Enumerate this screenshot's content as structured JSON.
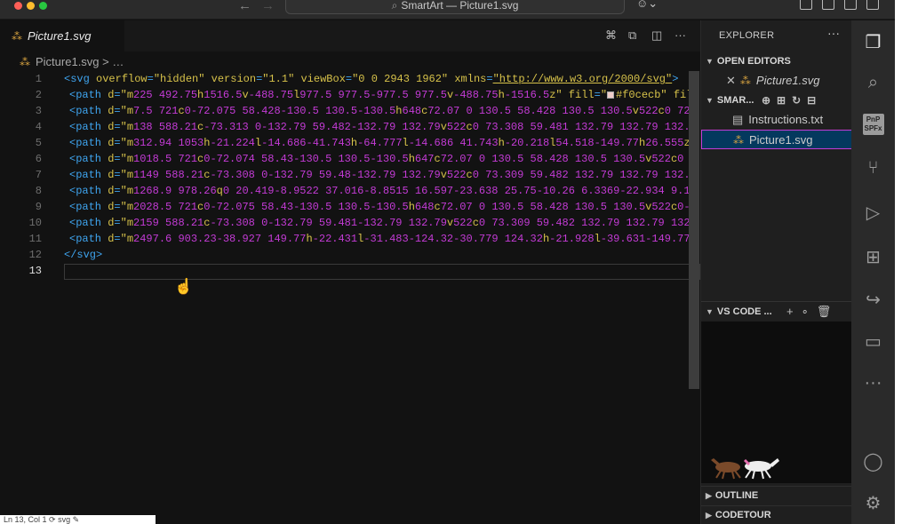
{
  "titlebar": {
    "back_glyph": "←",
    "forward_glyph": "→",
    "command_center_text": "SmartArt — Picture1.svg",
    "search_glyph": "⌕",
    "copilot_glyph": "☺⌄"
  },
  "editor": {
    "tab_label": "Picture1.svg",
    "tab_icon": "svg-file-icon",
    "breadcrumb_file": "Picture1.svg",
    "breadcrumb_rest": "> …",
    "line_numbers": [
      "1",
      "2",
      "3",
      "4",
      "5",
      "6",
      "7",
      "8",
      "9",
      "10",
      "11",
      "12",
      "13"
    ],
    "current_line": "13",
    "lines": [
      [
        [
          "tag",
          "<svg "
        ],
        [
          "attr",
          "overflow"
        ],
        [
          "tag",
          "="
        ],
        [
          "str",
          "\"hidden\""
        ],
        [
          "tag",
          " "
        ],
        [
          "attr",
          "version"
        ],
        [
          "tag",
          "="
        ],
        [
          "str",
          "\"1.1\""
        ],
        [
          "tag",
          " "
        ],
        [
          "attr",
          "viewBox"
        ],
        [
          "tag",
          "="
        ],
        [
          "str",
          "\"0 0 2943 1962\""
        ],
        [
          "tag",
          " "
        ],
        [
          "attr",
          "xmlns"
        ],
        [
          "tag",
          "="
        ],
        [
          "url",
          "\"http://www.w3.org/2000/svg\""
        ],
        [
          "tag",
          ">"
        ]
      ],
      [
        [
          "tag",
          "<path "
        ],
        [
          "attr",
          "d"
        ],
        [
          "tag",
          "="
        ],
        [
          "str",
          "\""
        ],
        [
          "cmd",
          "m"
        ],
        [
          "num",
          "225 492.75"
        ],
        [
          "cmd",
          "h"
        ],
        [
          "num",
          "1516.5"
        ],
        [
          "cmd",
          "v"
        ],
        [
          "num",
          "-488.75"
        ],
        [
          "cmd",
          "l"
        ],
        [
          "num",
          "977.5 977.5-977.5 977.5"
        ],
        [
          "cmd",
          "v"
        ],
        [
          "num",
          "-488.75"
        ],
        [
          "cmd",
          "h"
        ],
        [
          "num",
          "-1516.5"
        ],
        [
          "cmd",
          "z"
        ],
        [
          "str",
          "\""
        ],
        [
          "tag",
          " "
        ],
        [
          "attr",
          "fill"
        ],
        [
          "tag",
          "="
        ],
        [
          "str",
          "\""
        ],
        [
          "swatch",
          "#f0cecb"
        ],
        [
          "str",
          "#f0cecb\""
        ],
        [
          "tag",
          " "
        ],
        [
          "attr",
          "fill"
        ]
      ],
      [
        [
          "tag",
          "<path "
        ],
        [
          "attr",
          "d"
        ],
        [
          "tag",
          "="
        ],
        [
          "str",
          "\""
        ],
        [
          "cmd",
          "m"
        ],
        [
          "num",
          "7.5 721"
        ],
        [
          "cmd",
          "c"
        ],
        [
          "num",
          "0-72.075 58.428-130.5 130.5-130.5"
        ],
        [
          "cmd",
          "h"
        ],
        [
          "num",
          "648"
        ],
        [
          "cmd",
          "c"
        ],
        [
          "num",
          "72.07 0 130.5 58.428 130.5 130.5"
        ],
        [
          "cmd",
          "v"
        ],
        [
          "num",
          "522"
        ],
        [
          "cmd",
          "c"
        ],
        [
          "num",
          "0 72."
        ]
      ],
      [
        [
          "tag",
          "<path "
        ],
        [
          "attr",
          "d"
        ],
        [
          "tag",
          "="
        ],
        [
          "str",
          "\""
        ],
        [
          "cmd",
          "m"
        ],
        [
          "num",
          "138 588.21"
        ],
        [
          "cmd",
          "c"
        ],
        [
          "num",
          "-73.313 0-132.79 59.482-132.79 132.79"
        ],
        [
          "cmd",
          "v"
        ],
        [
          "num",
          "522"
        ],
        [
          "cmd",
          "c"
        ],
        [
          "num",
          "0 73.308 59.481 132.79 132.79 132.7"
        ]
      ],
      [
        [
          "tag",
          "<path "
        ],
        [
          "attr",
          "d"
        ],
        [
          "tag",
          "="
        ],
        [
          "str",
          "\""
        ],
        [
          "cmd",
          "m"
        ],
        [
          "num",
          "312.94 1053"
        ],
        [
          "cmd",
          "h"
        ],
        [
          "num",
          "-21.224"
        ],
        [
          "cmd",
          "l"
        ],
        [
          "num",
          "-14.686-41.743"
        ],
        [
          "cmd",
          "h"
        ],
        [
          "num",
          "-64.777"
        ],
        [
          "cmd",
          "l"
        ],
        [
          "num",
          "-14.686 41.743"
        ],
        [
          "cmd",
          "h"
        ],
        [
          "num",
          "-20.218"
        ],
        [
          "cmd",
          "l"
        ],
        [
          "num",
          "54.518-149.77"
        ],
        [
          "cmd",
          "h"
        ],
        [
          "num",
          "26.555"
        ],
        [
          "cmd",
          "zm"
        ]
      ],
      [
        [
          "tag",
          "<path "
        ],
        [
          "attr",
          "d"
        ],
        [
          "tag",
          "="
        ],
        [
          "str",
          "\""
        ],
        [
          "cmd",
          "m"
        ],
        [
          "num",
          "1018.5 721"
        ],
        [
          "cmd",
          "c"
        ],
        [
          "num",
          "0-72.074 58.43-130.5 130.5-130.5"
        ],
        [
          "cmd",
          "h"
        ],
        [
          "num",
          "647"
        ],
        [
          "cmd",
          "c"
        ],
        [
          "num",
          "72.07 0 130.5 58.428 130.5 130.5"
        ],
        [
          "cmd",
          "v"
        ],
        [
          "num",
          "522"
        ],
        [
          "cmd",
          "c"
        ],
        [
          "num",
          "0 7"
        ]
      ],
      [
        [
          "tag",
          "<path "
        ],
        [
          "attr",
          "d"
        ],
        [
          "tag",
          "="
        ],
        [
          "str",
          "\""
        ],
        [
          "cmd",
          "m"
        ],
        [
          "num",
          "1149 588.21"
        ],
        [
          "cmd",
          "c"
        ],
        [
          "num",
          "-73.308 0-132.79 59.48-132.79 132.79"
        ],
        [
          "cmd",
          "v"
        ],
        [
          "num",
          "522"
        ],
        [
          "cmd",
          "c"
        ],
        [
          "num",
          "0 73.309 59.482 132.79 132.79 132.7"
        ]
      ],
      [
        [
          "tag",
          "<path "
        ],
        [
          "attr",
          "d"
        ],
        [
          "tag",
          "="
        ],
        [
          "str",
          "\""
        ],
        [
          "cmd",
          "m"
        ],
        [
          "num",
          "1268.9 978.26"
        ],
        [
          "cmd",
          "q"
        ],
        [
          "num",
          "0 20.419-8.9522 37.016-8.8515 16.597-23.638 25.75-10.26 6.3369-22.934 9.15"
        ]
      ],
      [
        [
          "tag",
          "<path "
        ],
        [
          "attr",
          "d"
        ],
        [
          "tag",
          "="
        ],
        [
          "str",
          "\""
        ],
        [
          "cmd",
          "m"
        ],
        [
          "num",
          "2028.5 721"
        ],
        [
          "cmd",
          "c"
        ],
        [
          "num",
          "0-72.075 58.43-130.5 130.5-130.5"
        ],
        [
          "cmd",
          "h"
        ],
        [
          "num",
          "648"
        ],
        [
          "cmd",
          "c"
        ],
        [
          "num",
          "72.07 0 130.5 58.428 130.5 130.5"
        ],
        [
          "cmd",
          "v"
        ],
        [
          "num",
          "522"
        ],
        [
          "cmd",
          "c"
        ],
        [
          "num",
          "0-7"
        ]
      ],
      [
        [
          "tag",
          "<path "
        ],
        [
          "attr",
          "d"
        ],
        [
          "tag",
          "="
        ],
        [
          "str",
          "\""
        ],
        [
          "cmd",
          "m"
        ],
        [
          "num",
          "2159 588.21"
        ],
        [
          "cmd",
          "c"
        ],
        [
          "num",
          "-73.308 0-132.79 59.481-132.79 132.79"
        ],
        [
          "cmd",
          "v"
        ],
        [
          "num",
          "522"
        ],
        [
          "cmd",
          "c"
        ],
        [
          "num",
          "0 73.309 59.482 132.79 132.79 132."
        ]
      ],
      [
        [
          "tag",
          "<path "
        ],
        [
          "attr",
          "d"
        ],
        [
          "tag",
          "="
        ],
        [
          "str",
          "\""
        ],
        [
          "cmd",
          "m"
        ],
        [
          "num",
          "2497.6 903.23-38.927 149.77"
        ],
        [
          "cmd",
          "h"
        ],
        [
          "num",
          "-22.431"
        ],
        [
          "cmd",
          "l"
        ],
        [
          "num",
          "-31.483-124.32-30.779 124.32"
        ],
        [
          "cmd",
          "h"
        ],
        [
          "num",
          "-21.928"
        ],
        [
          "cmd",
          "l"
        ],
        [
          "num",
          "-39.631-149.77"
        ],
        [
          "cmd",
          "h"
        ]
      ],
      [
        [
          "tag",
          "</svg>"
        ]
      ],
      []
    ],
    "cursor_glyph": "☝"
  },
  "sidebar": {
    "title": "EXPLORER",
    "more_glyph": "···",
    "open_editors_label": "OPEN EDITORS",
    "open_editor_item": "Picture1.svg",
    "open_editor_close_glyph": "✕",
    "folder_label": "SMAR...",
    "folder_actions": "⊕⊞↻⊟",
    "files": [
      "Instructions.txt",
      "Picture1.svg"
    ],
    "vscode_section_label": "VS CODE ...",
    "vscode_actions": "+∘🗑",
    "outline_label": "OUTLINE",
    "codetour_label": "CODETOUR"
  },
  "activity": {
    "icons": [
      "explorer-icon",
      "search-icon",
      "pnp-spfx-icon",
      "source-control-icon",
      "run-debug-icon",
      "extensions-icon",
      "live-share-icon",
      "remote-explorer-icon",
      "more-icon",
      "account-icon",
      "settings-gear-icon"
    ],
    "pnp_label": "PnP SPFx",
    "more_glyph": "···"
  },
  "status": {
    "text": "Ln 13, Col 1  ⟳ svg  ✎"
  },
  "colors": {
    "tag": "#3fa5f0",
    "attr": "#d7c24a",
    "number": "#c43bd6",
    "selection_border": "#c43bd6",
    "selected_file_bg": "#04395e"
  }
}
